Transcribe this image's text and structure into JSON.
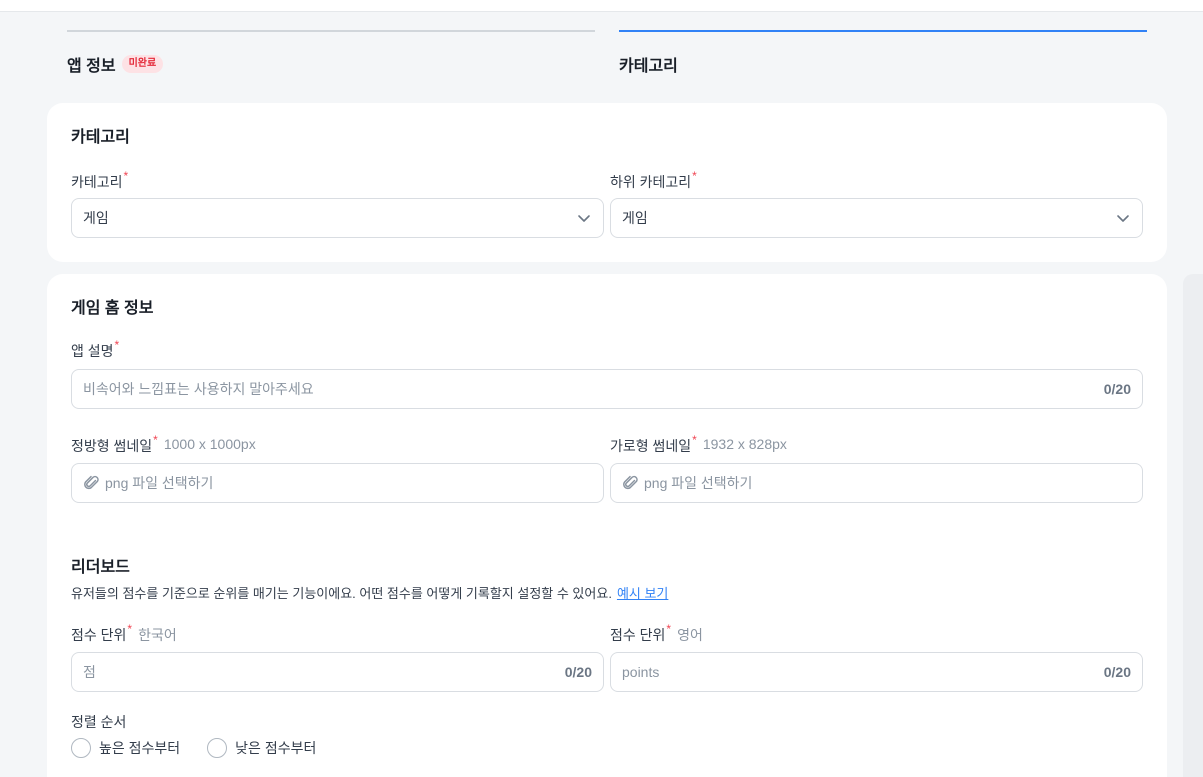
{
  "steps": [
    {
      "label": "앱 정보",
      "badge": "미완료"
    },
    {
      "label": "카테고리"
    }
  ],
  "category_card": {
    "title": "카테고리",
    "category_label": "카테고리",
    "category_value": "게임",
    "subcategory_label": "하위 카테고리",
    "subcategory_value": "게임"
  },
  "game_card": {
    "title": "게임 홈 정보",
    "app_desc_label": "앱 설명",
    "app_desc_placeholder": "비속어와 느낌표는 사용하지 말아주세요",
    "app_desc_count": "0/20",
    "square_thumb_label": "정방형 썸네일",
    "square_thumb_hint": "1000 x 1000px",
    "square_thumb_placeholder": "png 파일 선택하기",
    "wide_thumb_label": "가로형 썸네일",
    "wide_thumb_hint": "1932 x 828px",
    "wide_thumb_placeholder": "png 파일 선택하기",
    "leaderboard_title": "리더보드",
    "leaderboard_desc": "유저들의 점수를 기준으로 순위를 매기는 기능이에요. 어떤 점수를 어떻게 기록할지 설정할 수 있어요.",
    "leaderboard_link": "예시 보기",
    "unit_ko_label": "점수 단위",
    "unit_ko_hint": "한국어",
    "unit_ko_placeholder": "점",
    "unit_ko_count": "0/20",
    "unit_en_label": "점수 단위",
    "unit_en_hint": "영어",
    "unit_en_placeholder": "points",
    "unit_en_count": "0/20",
    "sort_label": "정렬 순서",
    "sort_options": [
      "높은 점수부터",
      "낮은 점수부터"
    ]
  },
  "colors": {
    "accent": "#3182f6",
    "required": "#f04452",
    "badge_bg": "#fde2e5"
  }
}
